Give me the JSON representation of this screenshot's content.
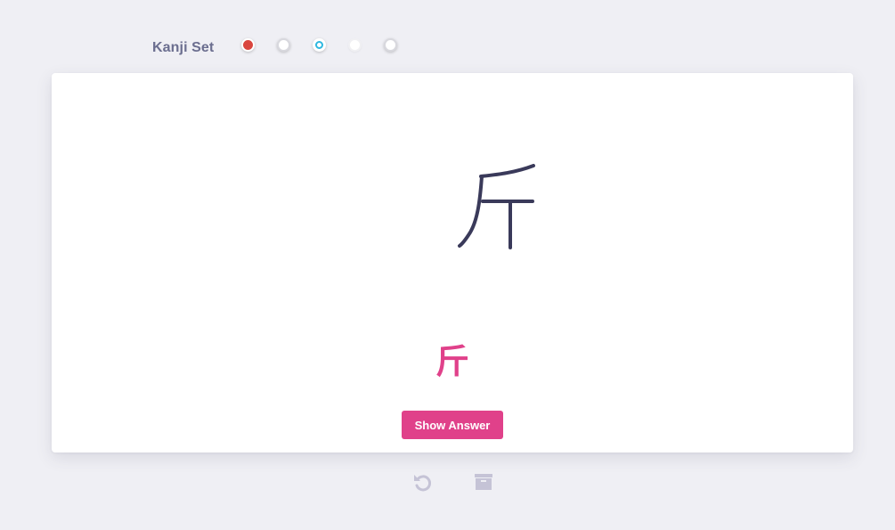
{
  "header": {
    "set_title": "Kanji Set",
    "dots": [
      {
        "name": "red",
        "color": "#d9453e",
        "state": "filled"
      },
      {
        "name": "white",
        "color": "#ffffff",
        "state": "empty"
      },
      {
        "name": "blue",
        "color": "#2fb8e0",
        "state": "ring"
      },
      {
        "name": "faint",
        "color": "#f0f0f3",
        "state": "faint"
      },
      {
        "name": "white",
        "color": "#ffffff",
        "state": "empty"
      }
    ]
  },
  "card": {
    "answer_kanji": "斤",
    "show_answer_label": "Show Answer"
  },
  "tools": {
    "undo_icon": "undo-icon",
    "archive_icon": "archive-icon"
  },
  "colors": {
    "accent": "#e0418a",
    "stroke": "#3a3a5a",
    "icon": "#c5c3d6",
    "background": "#efeff4"
  }
}
